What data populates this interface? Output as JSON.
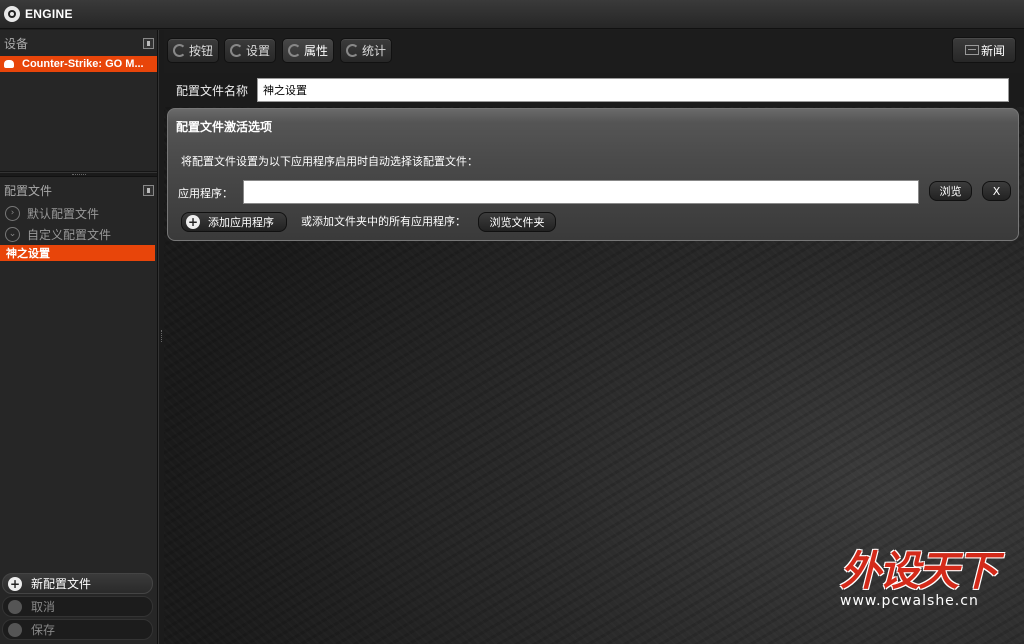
{
  "app": {
    "title": "ENGINE"
  },
  "sidebar": {
    "devices_header": "设备",
    "device_item": "Counter-Strike: GO M...",
    "profiles_header": "配置文件",
    "profiles": [
      {
        "label": "默认配置文件",
        "icon": "chevron-right-icon"
      },
      {
        "label": "自定义配置文件",
        "icon": "chevron-down-icon"
      }
    ],
    "active_profile": "神之设置",
    "new_profile": "新配置文件",
    "cancel": "取消",
    "save": "保存"
  },
  "toolbar": {
    "tabs": [
      {
        "label": "按钮"
      },
      {
        "label": "设置"
      },
      {
        "label": "属性",
        "active": true
      },
      {
        "label": "统计"
      }
    ],
    "news": "新闻"
  },
  "profile": {
    "name_label": "配置文件名称",
    "name_value": "神之设置"
  },
  "activation": {
    "title": "配置文件激活选项",
    "description": "将配置文件设置为以下应用程序启用时自动选择该配置文件：",
    "app_label": "应用程序：",
    "app_value": "",
    "browse": "浏览",
    "remove": "X",
    "add_app": "添加应用程序",
    "or_folder": "或添加文件夹中的所有应用程序：",
    "browse_folder": "浏览文件夹"
  },
  "watermark": {
    "main": "外设天下",
    "sub": "www.pcwalshe.cn"
  },
  "colors": {
    "accent": "#e8450a",
    "watermark": "#d42a1a"
  }
}
